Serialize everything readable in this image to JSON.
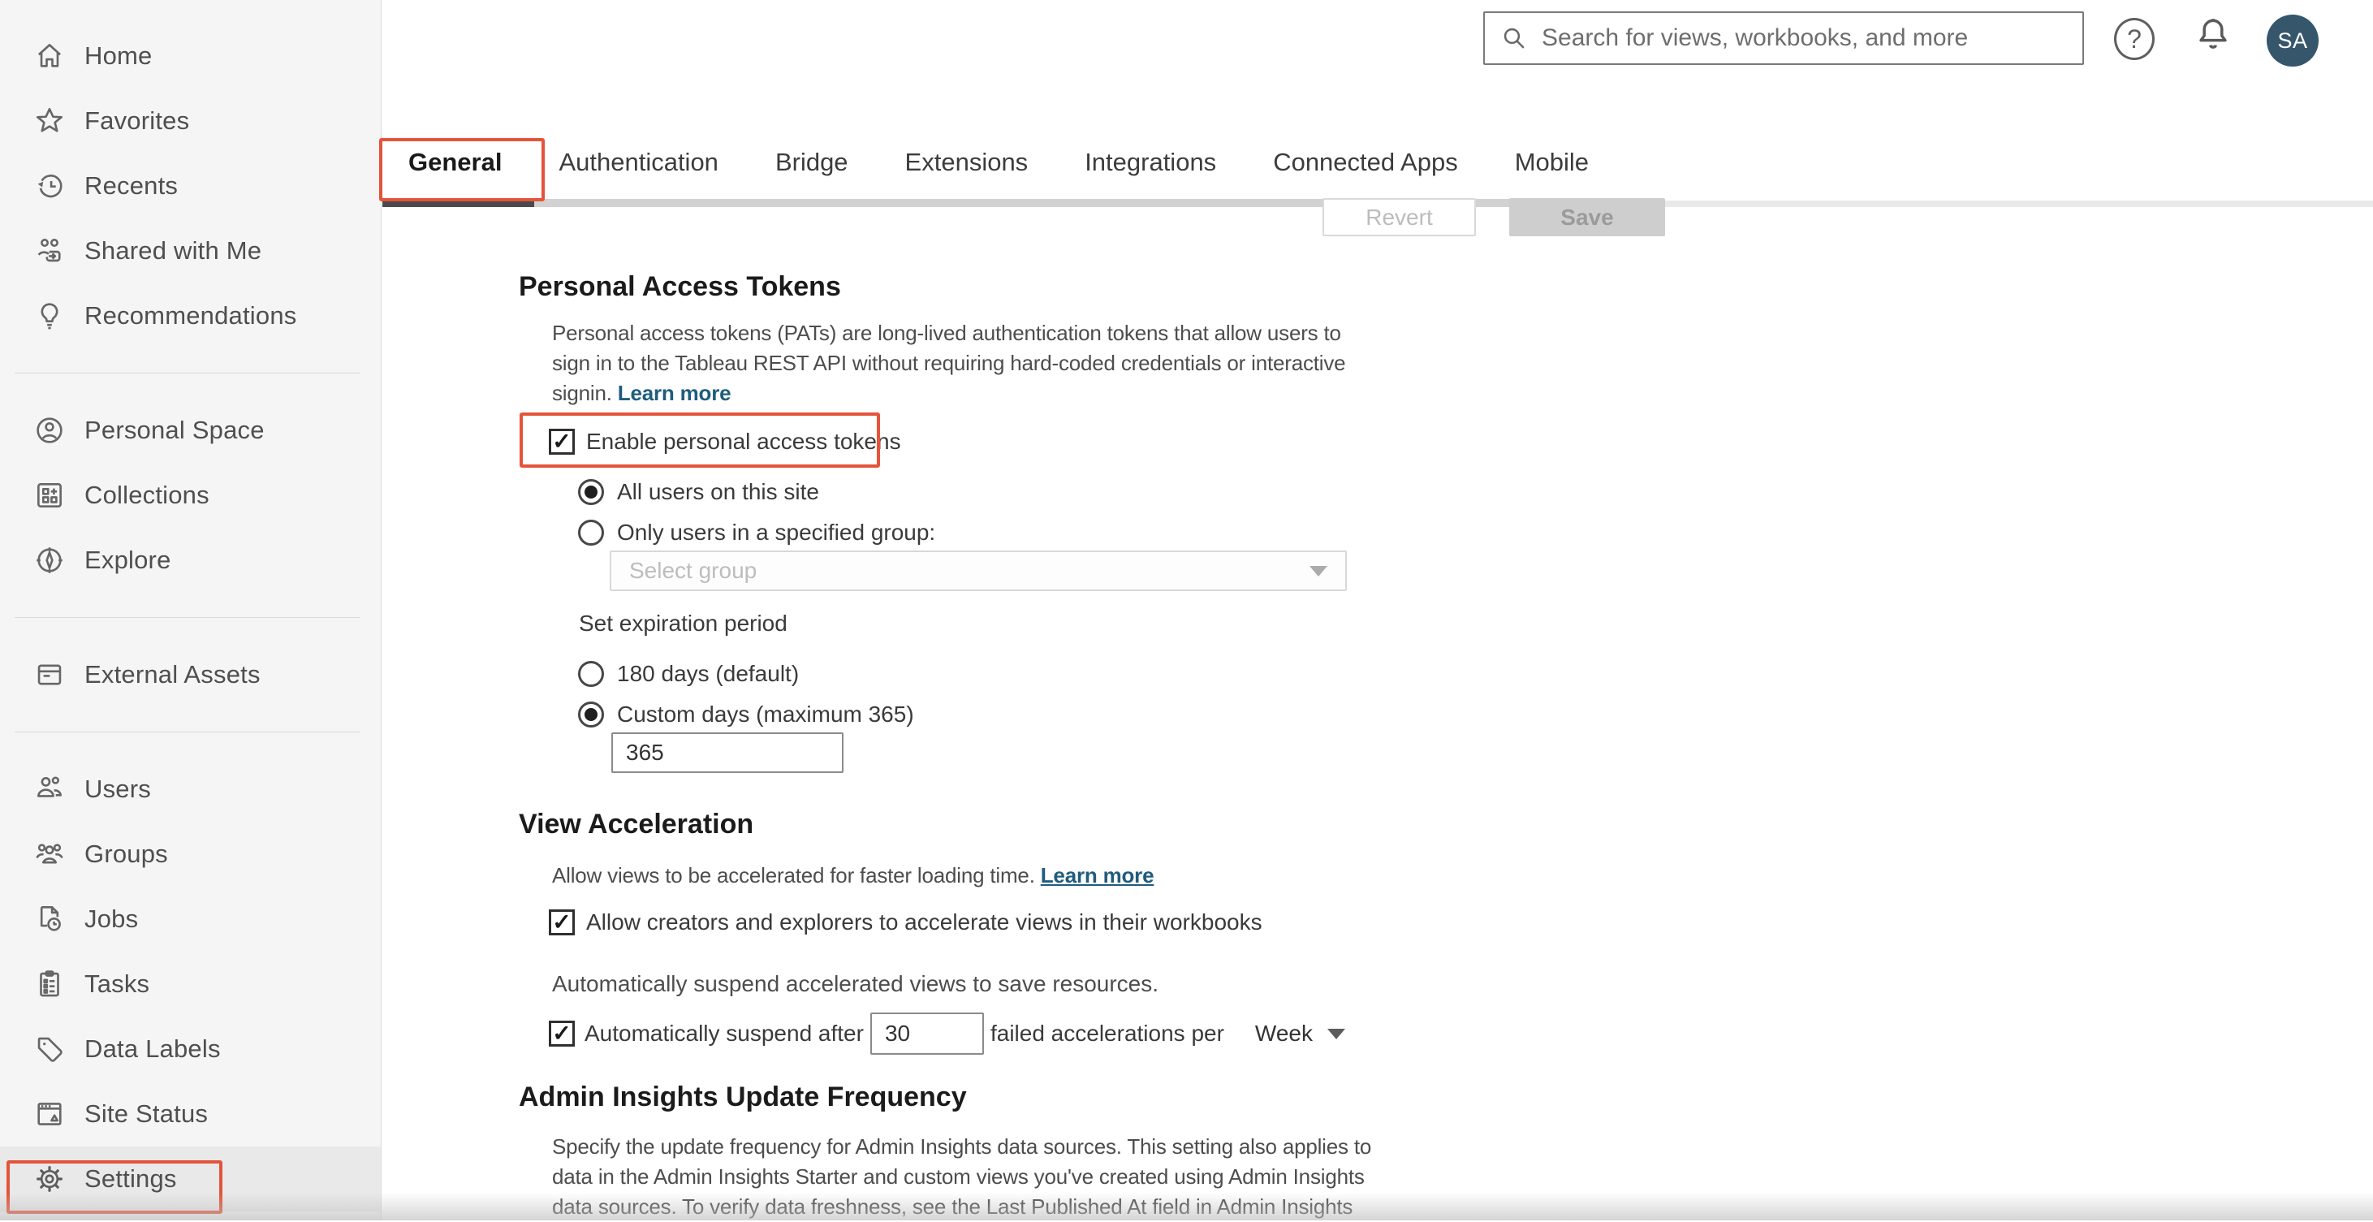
{
  "colors": {
    "annotation_red": "#e4543a",
    "link_blue": "#1f5c7d",
    "avatar_bg": "#35566b",
    "active_tab_underline": "#4a4a4a",
    "sidebar_bg": "#f5f5f5",
    "selected_item_bg": "#e9e9e9"
  },
  "header": {
    "search_placeholder": "Search for views, workbooks, and more",
    "avatar_initials": "SA"
  },
  "sidebar": {
    "items": [
      {
        "label": "Home",
        "icon": "home-icon"
      },
      {
        "label": "Favorites",
        "icon": "star-icon"
      },
      {
        "label": "Recents",
        "icon": "recents-icon"
      },
      {
        "label": "Shared with Me",
        "icon": "shared-with-me-icon"
      },
      {
        "label": "Recommendations",
        "icon": "lightbulb-icon"
      },
      {
        "label": "Personal Space",
        "icon": "person-circle-icon"
      },
      {
        "label": "Collections",
        "icon": "collections-icon"
      },
      {
        "label": "Explore",
        "icon": "compass-icon"
      },
      {
        "label": "External Assets",
        "icon": "archive-icon"
      },
      {
        "label": "Users",
        "icon": "users-icon"
      },
      {
        "label": "Groups",
        "icon": "groups-icon"
      },
      {
        "label": "Jobs",
        "icon": "document-clock-icon"
      },
      {
        "label": "Tasks",
        "icon": "clipboard-icon"
      },
      {
        "label": "Data Labels",
        "icon": "tag-icon"
      },
      {
        "label": "Site Status",
        "icon": "browser-warning-icon"
      },
      {
        "label": "Settings",
        "icon": "gear-icon",
        "selected": true
      }
    ]
  },
  "tabs": {
    "items": [
      {
        "label": "General",
        "active": true
      },
      {
        "label": "Authentication"
      },
      {
        "label": "Bridge"
      },
      {
        "label": "Extensions"
      },
      {
        "label": "Integrations"
      },
      {
        "label": "Connected Apps"
      },
      {
        "label": "Mobile"
      }
    ]
  },
  "toolbar": {
    "revert_label": "Revert",
    "save_label": "Save"
  },
  "pat": {
    "title": "Personal Access Tokens",
    "description": "Personal access tokens (PATs) are long-lived authentication tokens that allow users to\nsign in to the Tableau REST API without requiring hard-coded credentials or interactive\nsignin.",
    "learn_more_label": "Learn more",
    "enable_checkbox_label": "Enable personal access tokens",
    "radio_all_users_label": "All users on this site",
    "radio_specified_group_label": "Only users in a specified group:",
    "group_select_placeholder": "Select group",
    "expiration_label": "Set expiration period",
    "radio_180_label": "180 days (default)",
    "radio_custom_label": "Custom days (maximum 365)",
    "custom_days_value": "365"
  },
  "view_acceleration": {
    "title": "View Acceleration",
    "description": "Allow views to be accelerated for faster loading time.",
    "learn_more_label": "Learn more",
    "allow_checkbox_label": "Allow creators and explorers to accelerate views in their workbooks",
    "suspend_intro": "Automatically suspend accelerated views to save resources.",
    "suspend_checkbox_label": "Automatically suspend after",
    "suspend_count_value": "30",
    "suspend_suffix": "failed accelerations per",
    "period_value": "Week"
  },
  "admin_insights": {
    "title": "Admin Insights Update Frequency",
    "description": "Specify the update frequency for Admin Insights data sources. This setting also applies to\ndata in the Admin Insights Starter and custom views you've created using Admin Insights\ndata sources. To verify data freshness, see the Last Published At field in Admin Insights"
  }
}
